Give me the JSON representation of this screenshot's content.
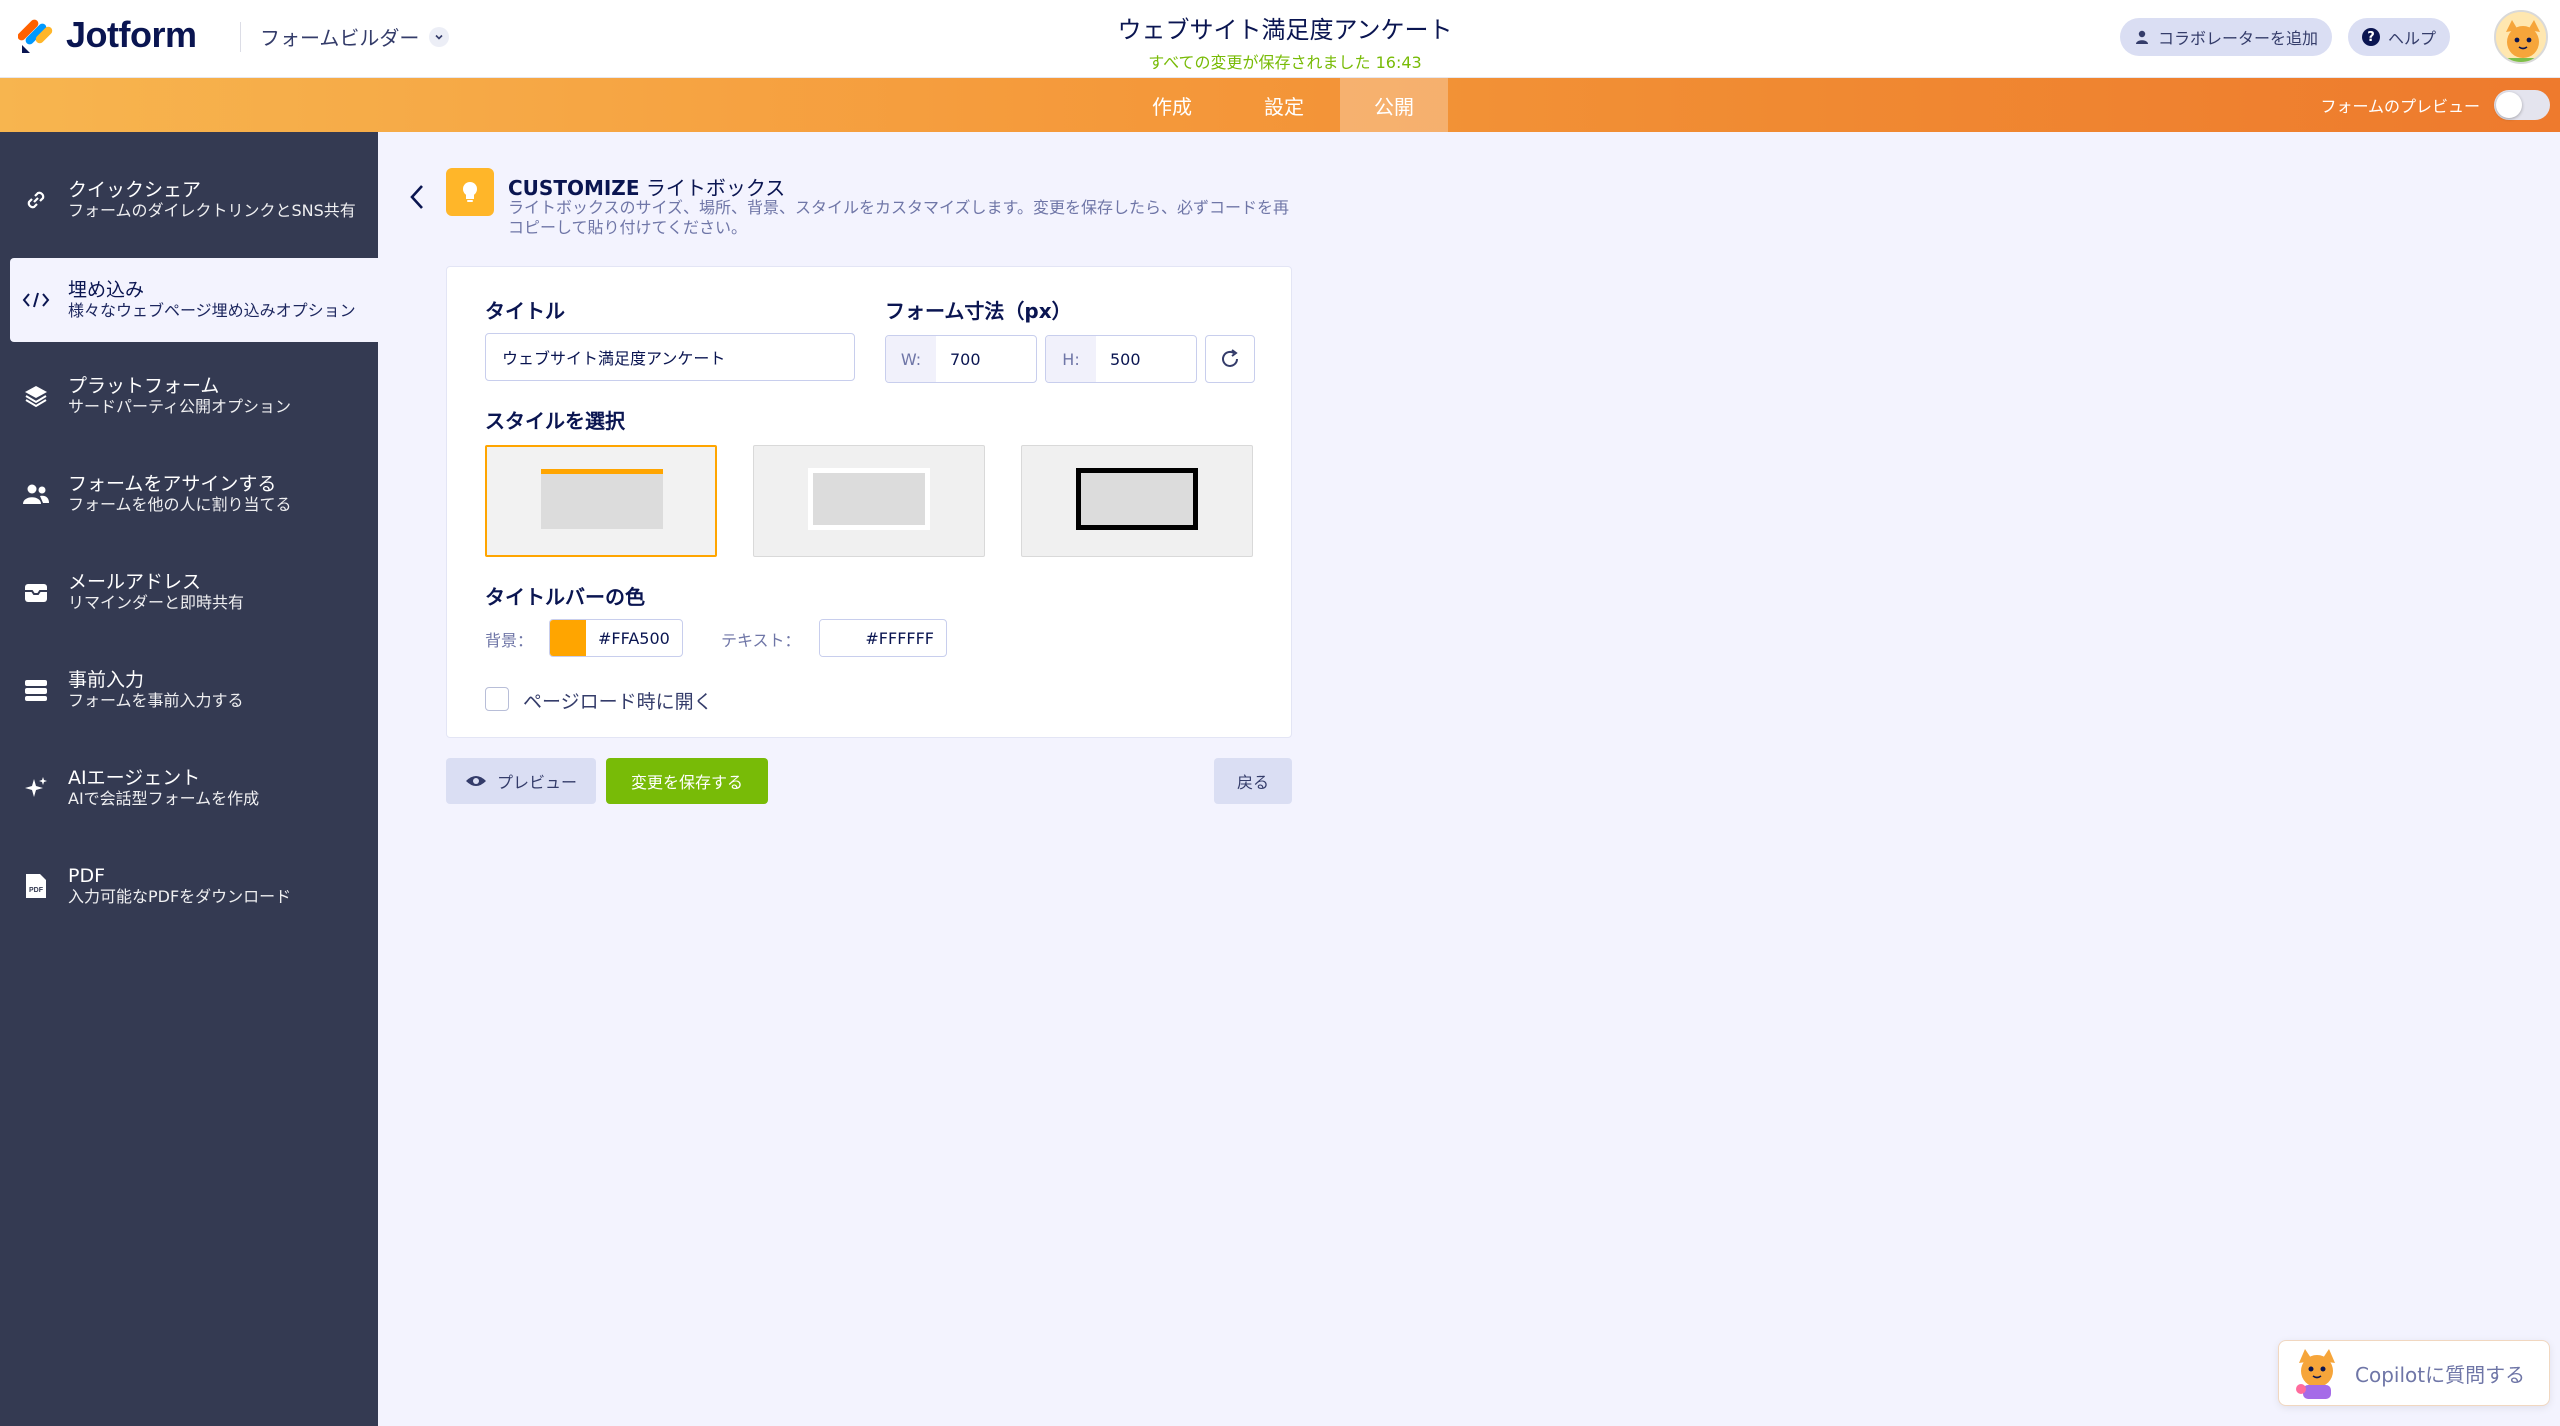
{
  "header": {
    "brand": "Jotform",
    "builder_label": "フォームビルダー",
    "form_title": "ウェブサイト満足度アンケート",
    "save_status": "すべての変更が保存されました 16:43",
    "collab_button": "コラボレーターを追加",
    "help_button": "ヘルプ"
  },
  "nav": {
    "tabs": [
      {
        "label": "作成"
      },
      {
        "label": "設定"
      },
      {
        "label": "公開"
      }
    ],
    "active_tab": "公開",
    "preview_toggle_label": "フォームのプレビュー",
    "preview_toggle_on": false
  },
  "sidebar": {
    "items": [
      {
        "title": "クイックシェア",
        "subtitle": "フォームのダイレクトリンクとSNS共有",
        "icon": "link-icon"
      },
      {
        "title": "埋め込み",
        "subtitle": "様々なウェブページ埋め込みオプション",
        "icon": "code-icon"
      },
      {
        "title": "プラットフォーム",
        "subtitle": "サードパーティ公開オプション",
        "icon": "layers-icon"
      },
      {
        "title": "フォームをアサインする",
        "subtitle": "フォームを他の人に割り当てる",
        "icon": "users-icon"
      },
      {
        "title": "メールアドレス",
        "subtitle": "リマインダーと即時共有",
        "icon": "mail-icon"
      },
      {
        "title": "事前入力",
        "subtitle": "フォームを事前入力する",
        "icon": "prefill-icon"
      },
      {
        "title": "AIエージェント",
        "subtitle": "AIで会話型フォームを作成",
        "icon": "sparkle-icon"
      },
      {
        "title": "PDF",
        "subtitle": "入力可能なPDFをダウンロード",
        "icon": "pdf-icon"
      }
    ],
    "active_index": 1
  },
  "panel": {
    "heading_bold": "CUSTOMIZE",
    "heading_rest": " ライトボックス",
    "description": "ライトボックスのサイズ、場所、背景、スタイルをカスタマイズします。変更を保存したら、必ずコードを再コピーして貼り付けてください。",
    "title_label": "タイトル",
    "title_value": "ウェブサイト満足度アンケート",
    "size_label": "フォーム寸法（px）",
    "width_prefix": "W:",
    "width_value": "700",
    "height_prefix": "H:",
    "height_value": "500",
    "style_label": "スタイルを選択",
    "selected_style": 0,
    "titlebar_label": "タイトルバーの色",
    "bg_label": "背景：",
    "bg_color": "#FFA500",
    "text_label": "テキスト：",
    "text_color": "#FFFFFF",
    "open_on_load_label": "ページロード時に開く",
    "open_on_load_checked": false
  },
  "actions": {
    "preview": "プレビュー",
    "save": "変更を保存する",
    "back": "戻る"
  },
  "copilot": {
    "label": "Copilotに質問する"
  },
  "colors": {
    "accent_orange": "#FFA500",
    "save_green": "#78BB07",
    "sidebar_bg": "#343A52",
    "brand_navy": "#0A1551"
  }
}
